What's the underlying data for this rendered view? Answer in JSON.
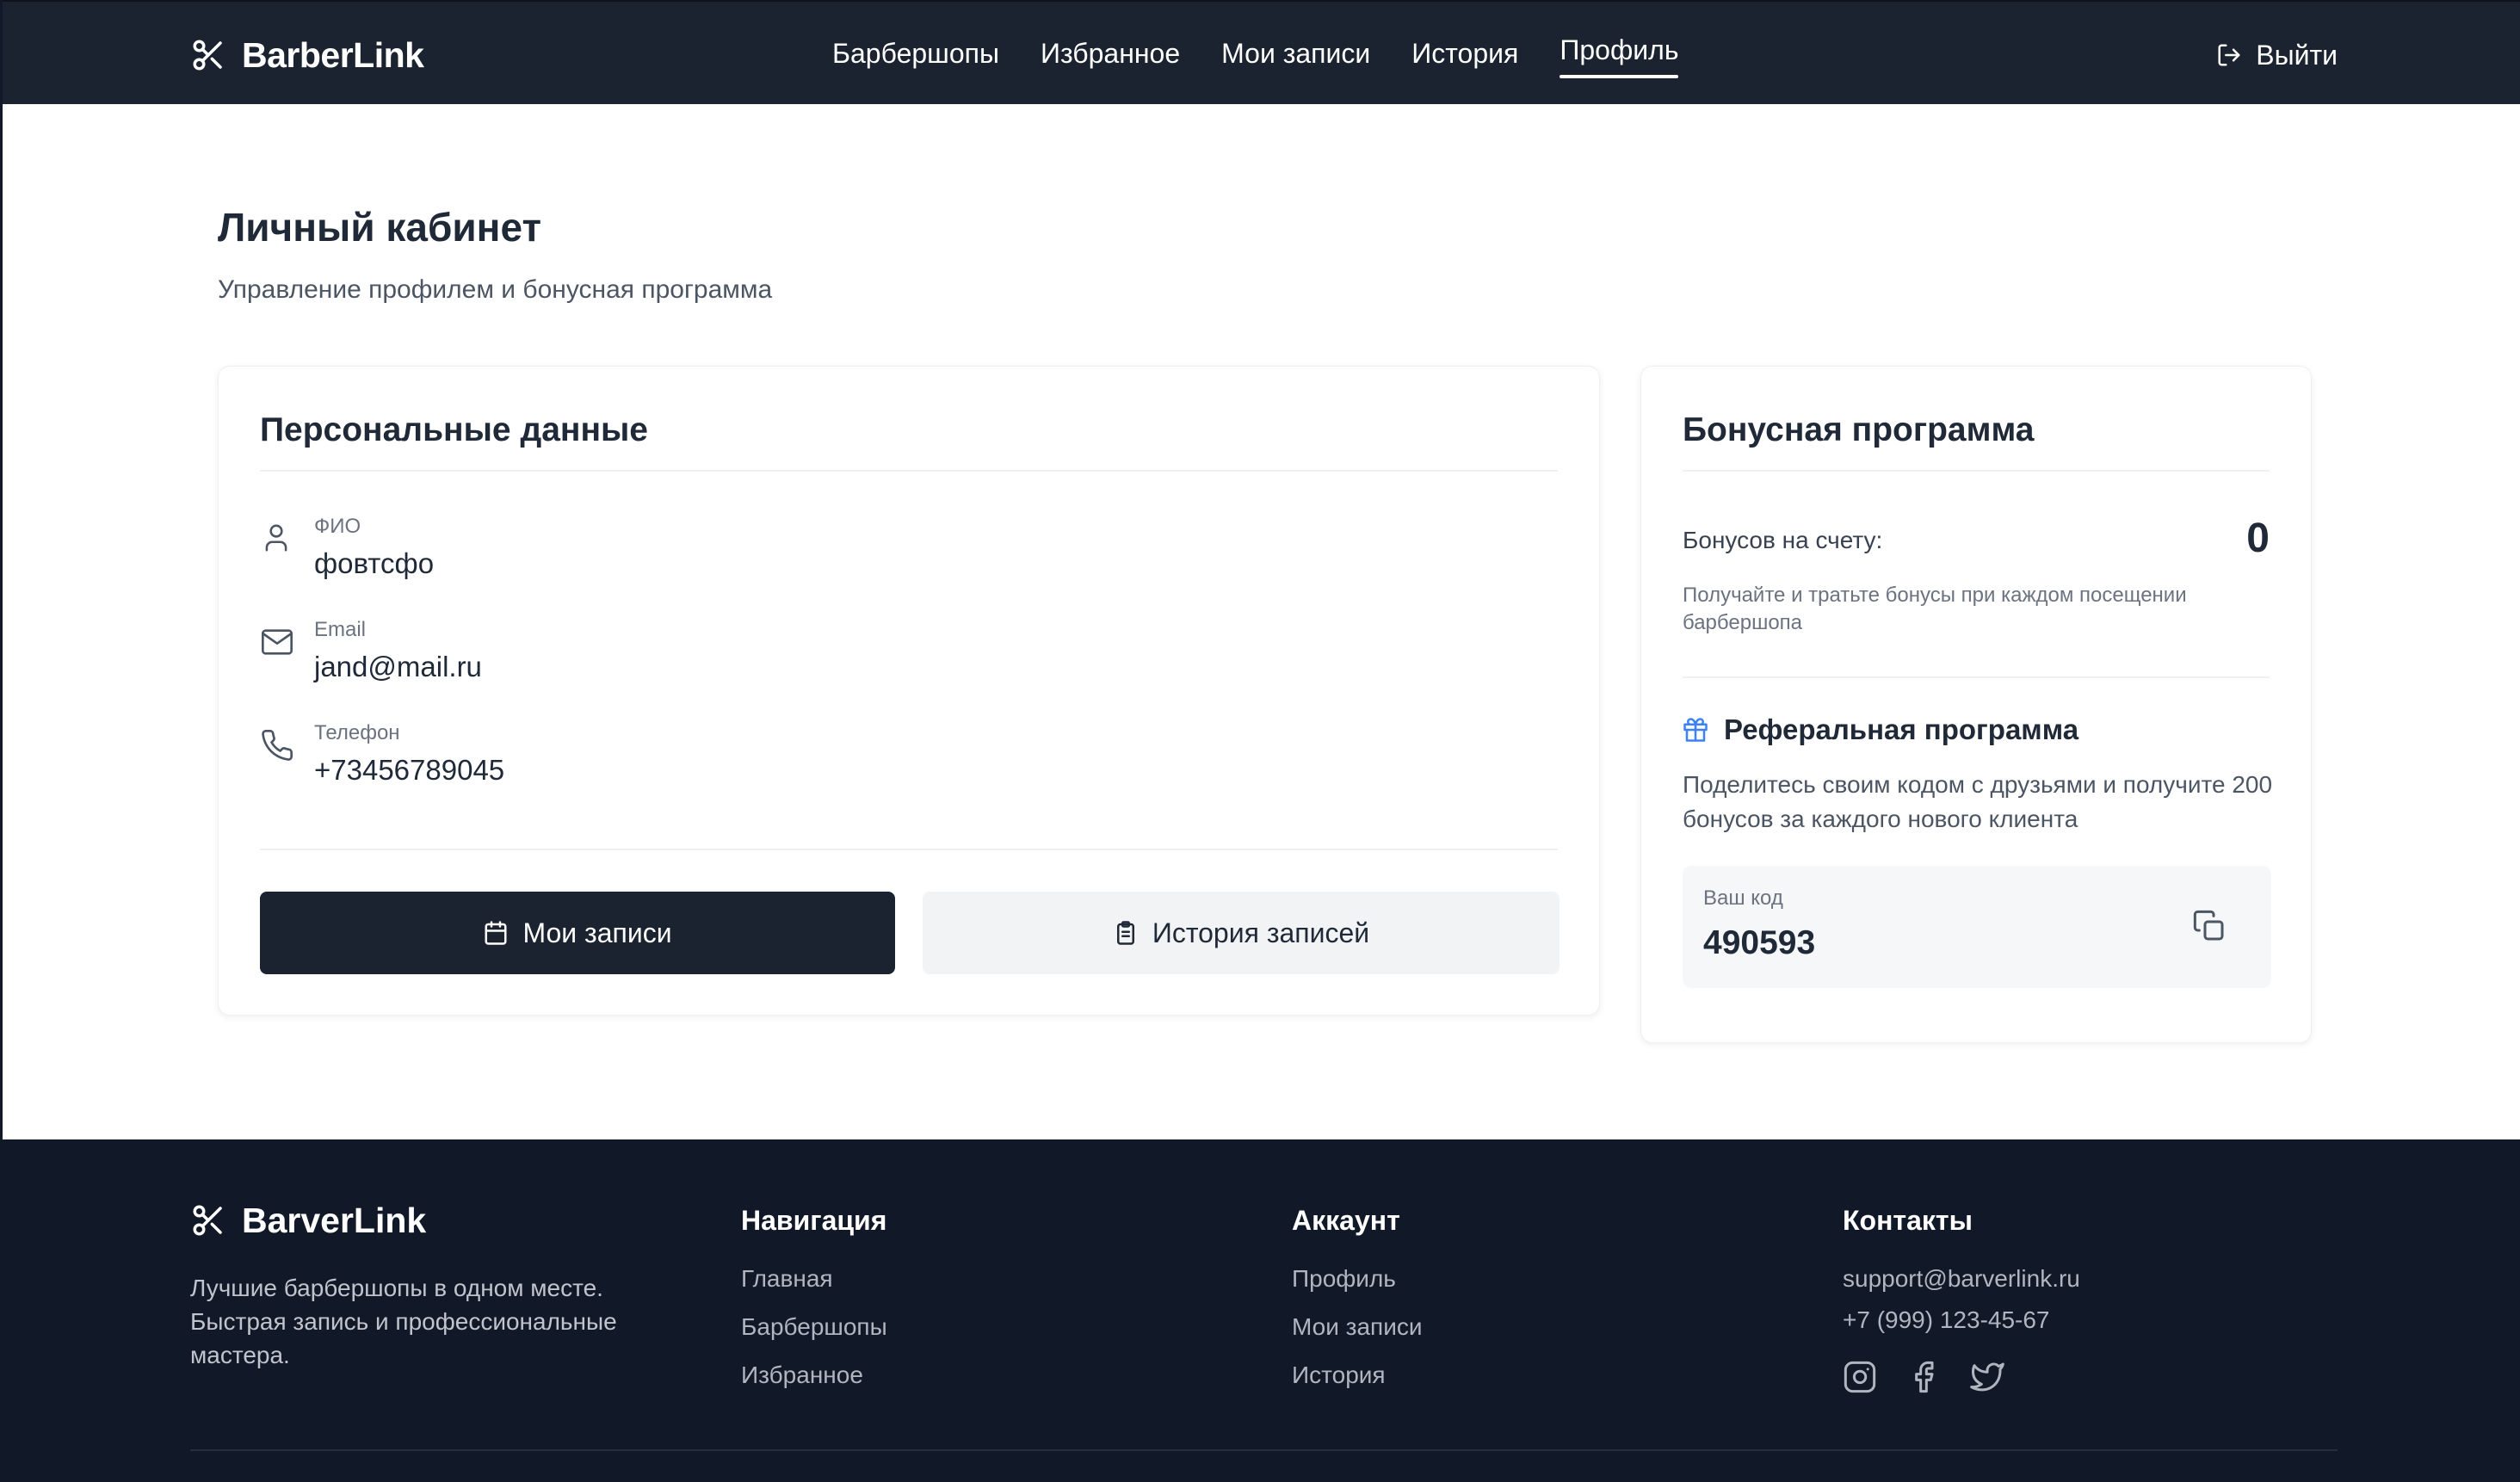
{
  "header": {
    "brand": "BarberLink",
    "nav": [
      {
        "label": "Барбершопы",
        "active": false
      },
      {
        "label": "Избранное",
        "active": false
      },
      {
        "label": "Мои записи",
        "active": false
      },
      {
        "label": "История",
        "active": false
      },
      {
        "label": "Профиль",
        "active": true
      }
    ],
    "logout_label": "Выйти"
  },
  "page": {
    "title": "Личный кабинет",
    "subtitle": "Управление профилем и бонусная программа"
  },
  "personal": {
    "title": "Персональные данные",
    "fields": [
      {
        "icon": "user-icon",
        "label": "ФИО",
        "value": "фовтсфо"
      },
      {
        "icon": "mail-icon",
        "label": "Email",
        "value": "jand@mail.ru"
      },
      {
        "icon": "phone-icon",
        "label": "Телефон",
        "value": "+73456789045"
      }
    ],
    "buttons": {
      "appointments": "Мои записи",
      "history": "История записей"
    }
  },
  "bonus": {
    "title": "Бонусная программа",
    "balance_label": "Бонусов на счету:",
    "balance_value": "0",
    "balance_desc": "Получайте и тратьте бонусы при каждом посещении барбершопа",
    "referral_title": "Реферальная программа",
    "referral_desc": "Поделитесь своим кодом с друзьями и получите 200 бонусов за каждого нового клиента",
    "code_label": "Ваш код",
    "code_value": "490593"
  },
  "footer": {
    "brand": "BarverLink",
    "tagline": "Лучшие барбершопы в одном месте. Быстрая запись и профессиональные мастера.",
    "navigation": {
      "title": "Навигация",
      "links": [
        "Главная",
        "Барбершопы",
        "Избранное"
      ]
    },
    "account": {
      "title": "Аккаунт",
      "links": [
        "Профиль",
        "Мои записи",
        "История"
      ]
    },
    "contacts": {
      "title": "Контакты",
      "email": "support@barverlink.ru",
      "phone": "+7 (999) 123-45-67",
      "socials": [
        "instagram-icon",
        "facebook-icon",
        "twitter-icon"
      ]
    }
  },
  "colors": {
    "header_bg": "#1b2331",
    "footer_bg": "#111827",
    "primary_button": "#1b2331",
    "secondary_button": "#f2f3f5",
    "gift_icon": "#3b82f6"
  }
}
